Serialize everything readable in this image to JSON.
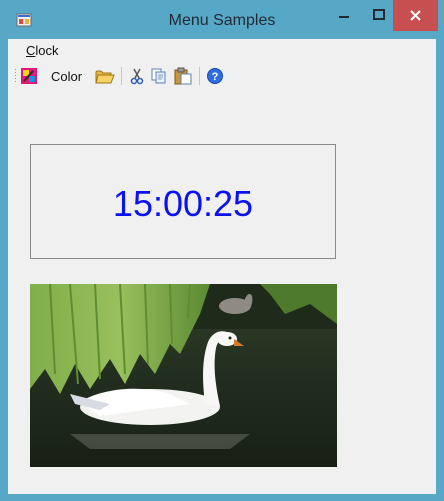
{
  "window": {
    "title": "Menu Samples",
    "accent_color": "#57a7c7",
    "close_color": "#c74f4f"
  },
  "menu": {
    "items": [
      {
        "label": "Clock",
        "mnemonic": "C",
        "rest": "lock"
      }
    ]
  },
  "toolbar": {
    "color_label": "Color",
    "buttons": [
      {
        "icon": "color-icon"
      },
      {
        "icon": "open-folder-icon"
      },
      {
        "icon": "cut-icon"
      },
      {
        "icon": "copy-icon"
      },
      {
        "icon": "paste-icon"
      },
      {
        "icon": "help-icon"
      }
    ]
  },
  "clock": {
    "time": "15:00:25",
    "color": "#0b12f2"
  },
  "image": {
    "subject": "swan-photo"
  }
}
